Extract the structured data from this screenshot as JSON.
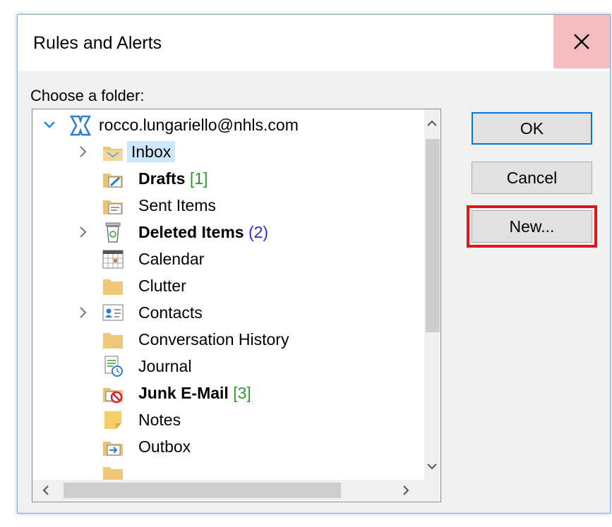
{
  "dialog": {
    "title": "Rules and Alerts",
    "close_icon": "close-icon",
    "prompt": "Choose a folder:"
  },
  "tree": {
    "account": "rocco.lungariello@nhls.com",
    "items": [
      {
        "label": "Inbox",
        "count": "",
        "icon": "inbox-folder-icon",
        "selected": true,
        "expandable": true
      },
      {
        "label": "Drafts",
        "count": "[1]",
        "icon": "drafts-folder-icon",
        "bold": true
      },
      {
        "label": "Sent Items",
        "count": "",
        "icon": "sent-items-folder-icon"
      },
      {
        "label": "Deleted Items",
        "count": "(2)",
        "icon": "trash-icon",
        "bold": true,
        "expandable": true
      },
      {
        "label": "Calendar",
        "count": "",
        "icon": "calendar-icon"
      },
      {
        "label": "Clutter",
        "count": "",
        "icon": "folder-icon"
      },
      {
        "label": "Contacts",
        "count": "",
        "icon": "contact-card-icon",
        "expandable": true
      },
      {
        "label": "Conversation History",
        "count": "",
        "icon": "folder-icon"
      },
      {
        "label": "Journal",
        "count": "",
        "icon": "journal-icon"
      },
      {
        "label": "Junk E-Mail",
        "count": "[3]",
        "icon": "junk-folder-icon",
        "bold": true
      },
      {
        "label": "Notes",
        "count": "",
        "icon": "notes-icon"
      },
      {
        "label": "Outbox",
        "count": "",
        "icon": "outbox-folder-icon"
      }
    ]
  },
  "buttons": {
    "ok": "OK",
    "cancel": "Cancel",
    "new": "New..."
  },
  "colors": {
    "highlight": "#e3141c",
    "selection": "#cce8ff",
    "close_hover": "#f3bcbf"
  }
}
